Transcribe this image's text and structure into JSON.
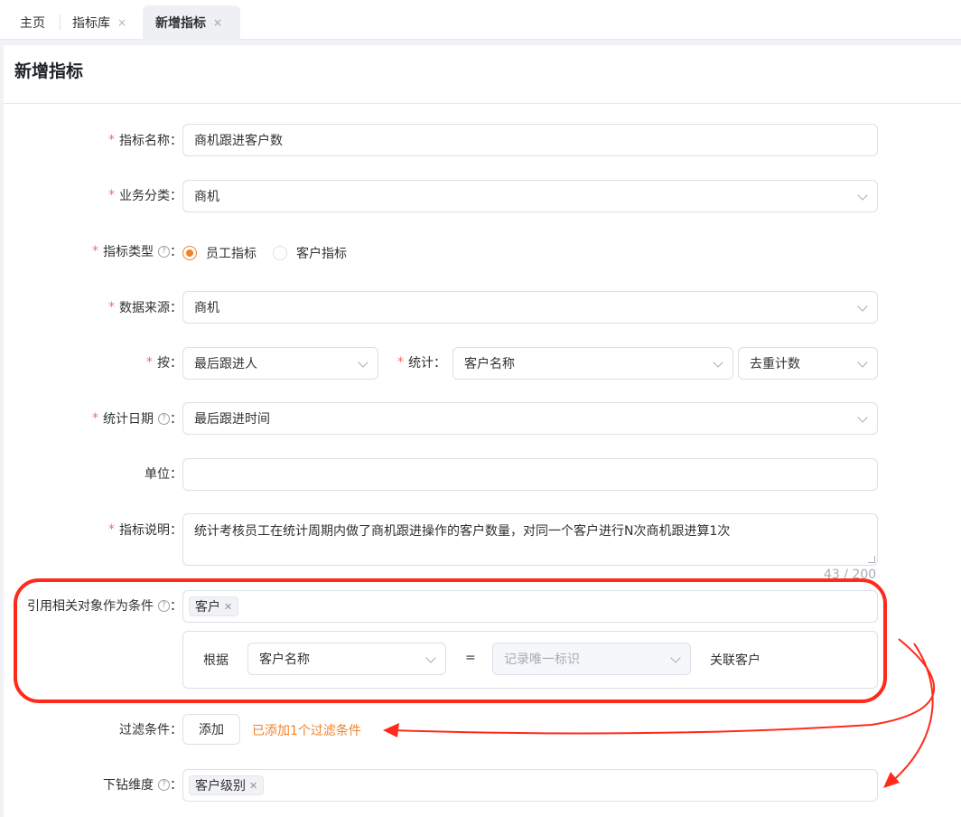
{
  "tabs": [
    {
      "label": "主页"
    },
    {
      "label": "指标库",
      "close": "×"
    },
    {
      "label": "新增指标",
      "close": "×"
    }
  ],
  "page_title": "新增指标",
  "form": {
    "name": {
      "label": "指标名称",
      "value": "商机跟进客户数"
    },
    "category": {
      "label": "业务分类",
      "value": "商机"
    },
    "type": {
      "label": "指标类型",
      "options": [
        "员工指标",
        "客户指标"
      ],
      "selected": "员工指标"
    },
    "source": {
      "label": "数据来源",
      "value": "商机"
    },
    "by": {
      "label": "按",
      "value": "最后跟进人"
    },
    "stat": {
      "label": "统计",
      "field": "客户名称",
      "method": "去重计数"
    },
    "date": {
      "label": "统计日期",
      "value": "最后跟进时间"
    },
    "unit": {
      "label": "单位",
      "value": ""
    },
    "desc": {
      "label": "指标说明",
      "value": "统计考核员工在统计周期内做了商机跟进操作的客户数量，对同一个客户进行N次商机跟进算1次",
      "counter": "43 / 200"
    },
    "related": {
      "label": "引用相关对象作为条件",
      "tags": [
        "客户"
      ],
      "rule": {
        "prefix": "根据",
        "field": "客户名称",
        "equals": "=",
        "target_placeholder": "记录唯一标识",
        "suffix": "关联客户"
      }
    },
    "filter": {
      "label": "过滤条件",
      "button": "添加",
      "hint": "已添加1个过滤条件"
    },
    "drill": {
      "label": "下钻维度",
      "tags": [
        "客户级别"
      ]
    }
  },
  "colors": {
    "accent": "#f0832a",
    "required": "#f56c6c",
    "annotation": "#ff2a1a"
  },
  "icons": {
    "help": "question-circle-icon",
    "close": "close-icon",
    "dropdown": "chevron-down-icon"
  }
}
